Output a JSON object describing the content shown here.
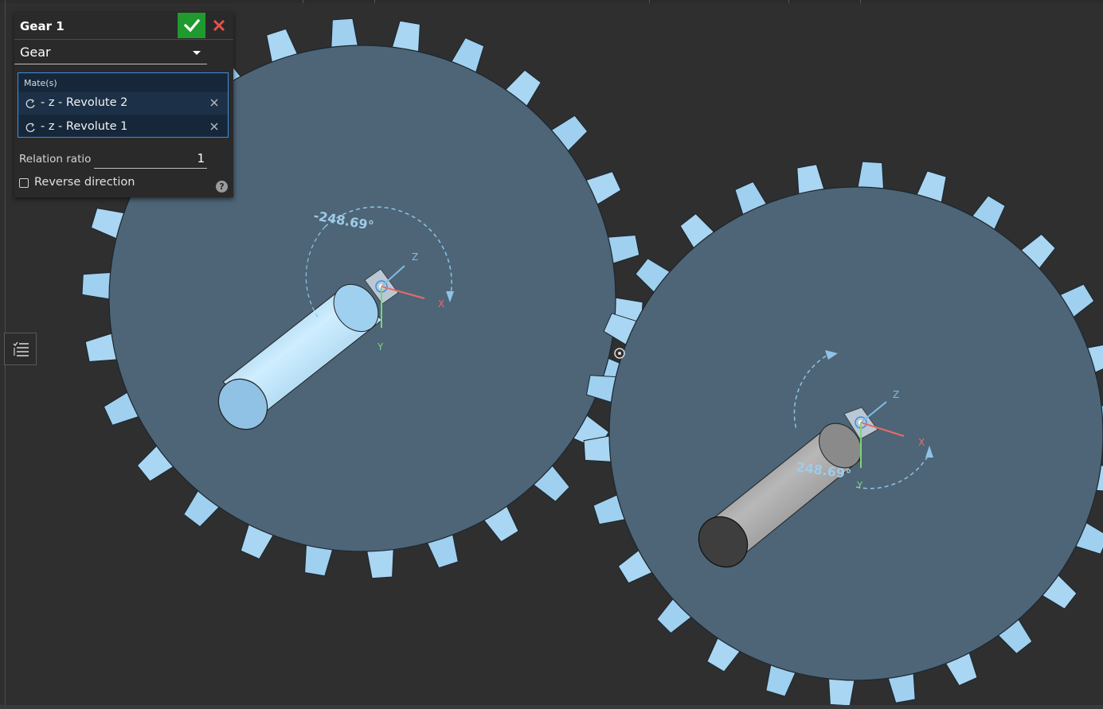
{
  "panel": {
    "title": "Gear 1",
    "type_value": "Gear",
    "mates_label": "Mate(s)",
    "mates": [
      {
        "label": "- z - Revolute 2"
      },
      {
        "label": "- z - Revolute 1"
      }
    ],
    "ratio_label": "Relation ratio",
    "ratio_value": "1",
    "reverse_label": "Reverse direction",
    "reverse_checked": false,
    "help_glyph": "?"
  },
  "viewport": {
    "gear_left": {
      "angle_label": "-248.69°"
    },
    "gear_right": {
      "angle_label": "248.69°"
    },
    "axis_labels": {
      "z": "Z",
      "x": "X",
      "y": "Y"
    }
  },
  "icons": {
    "accept": "check-icon",
    "cancel": "close-icon",
    "mate": "revolute-mate-icon",
    "remove": "remove-icon",
    "list": "list-icon",
    "help": "help-icon"
  },
  "colors": {
    "accept_green": "#1f9a2e",
    "cancel_red": "#e8524a",
    "selection_blue": "#3d8fe0",
    "gear_face": "#4d6577",
    "gear_tooth": "#9fd0ef",
    "axis_x": "#e76b6b",
    "axis_y": "#7fd36f",
    "axis_z": "#7fbde6"
  }
}
